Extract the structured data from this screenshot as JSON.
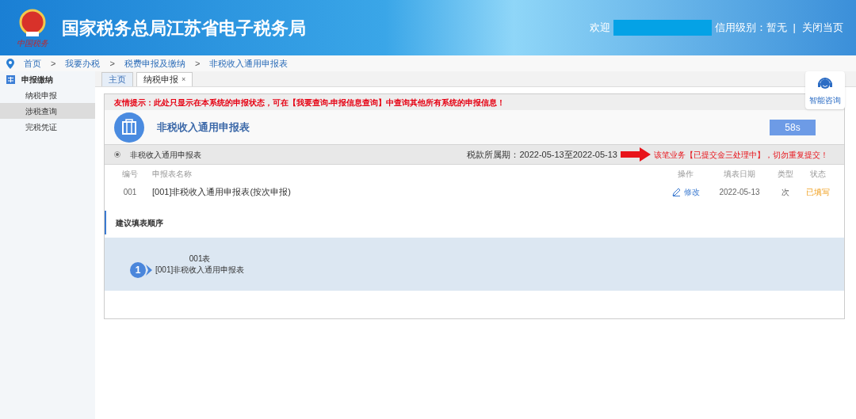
{
  "header": {
    "title": "国家税务总局江苏省电子税务局",
    "logo_caption": "中国税务",
    "welcome": "欢迎",
    "credit": "信用级别：暂无",
    "separator": "|",
    "close": "关闭当页"
  },
  "breadcrumb": [
    "首页",
    "我要办税",
    "税费申报及缴纳",
    "非税收入通用申报表"
  ],
  "breadcrumb_separator": ">",
  "sidebar": {
    "title": "申报缴纳",
    "items": [
      {
        "label": "纳税申报",
        "selected": false
      },
      {
        "label": "涉税查询",
        "selected": true
      },
      {
        "label": "完税凭证",
        "selected": false
      }
    ]
  },
  "tabs": [
    {
      "label": "主页",
      "selected": false,
      "closable": false
    },
    {
      "label": "纳税申报",
      "selected": true,
      "closable": true
    }
  ],
  "close_glyph": "×",
  "notice": "友情提示：此处只显示在本系统的申报状态，可在【我要查询-申报信息查询】中查询其他所有系统的申报信息！",
  "form_title": "非税收入通用申报表",
  "timer": "58s",
  "section": {
    "name": "非税收入通用申报表",
    "selected": true,
    "period": "税款所属期：2022-05-13至2022-05-13",
    "warning": "该笔业务【已提交金三处理中】，切勿重复提交！"
  },
  "table": {
    "columns": [
      "编号",
      "申报表名称",
      "操作",
      "填表日期",
      "类型",
      "状态"
    ],
    "rows": [
      {
        "code": "001",
        "name": "[001]非税收入通用申报表(按次申报)",
        "action": "修改",
        "date": "2022-05-13",
        "type": "次",
        "status": "已填写"
      }
    ]
  },
  "order": {
    "title": "建议填表顺序",
    "steps": [
      {
        "number": "1",
        "code": "001表",
        "name": "[001]非税收入通用申报表"
      }
    ]
  },
  "assistant": "智能咨询"
}
